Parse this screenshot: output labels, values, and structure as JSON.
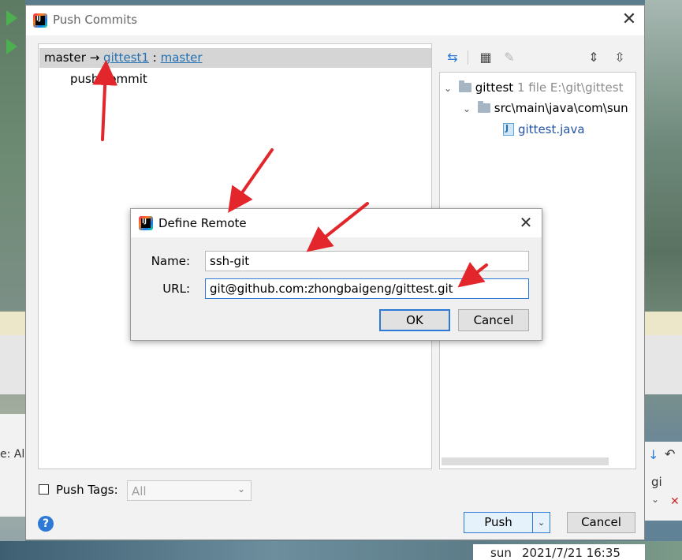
{
  "background": {
    "status_user": "sun",
    "status_datetime": "2021/7/21 16:35",
    "left_fragment": "e: Al",
    "right_fragment": "gi"
  },
  "dialog": {
    "title": "Push Commits",
    "app_icon_text": "IJ",
    "commits": {
      "local_branch": "master",
      "arrow": "→",
      "remote": "gittest1",
      "separator": ":",
      "remote_branch": "master",
      "commit_message": "push commit"
    },
    "changes": {
      "root_name": "gittest",
      "root_meta": "1 file  E:\\git\\gittest",
      "folder_path": "src\\main\\java\\com\\sun",
      "file_name": "gittest.java"
    },
    "push_tags_label": "Push Tags:",
    "tags_select_value": "All",
    "push_button": "Push",
    "cancel_button": "Cancel",
    "help_glyph": "?"
  },
  "define_remote": {
    "title": "Define Remote",
    "name_label": "Name:",
    "name_value": "ssh-git",
    "url_label": "URL:",
    "url_value": "git@github.com:zhongbaigeng/gittest.git",
    "ok_button": "OK",
    "cancel_button": "Cancel"
  },
  "colors": {
    "accent": "#2d7ad6",
    "link": "#2470b3",
    "annotation_arrow": "#e3262b",
    "selection": "#d5d5d5"
  }
}
